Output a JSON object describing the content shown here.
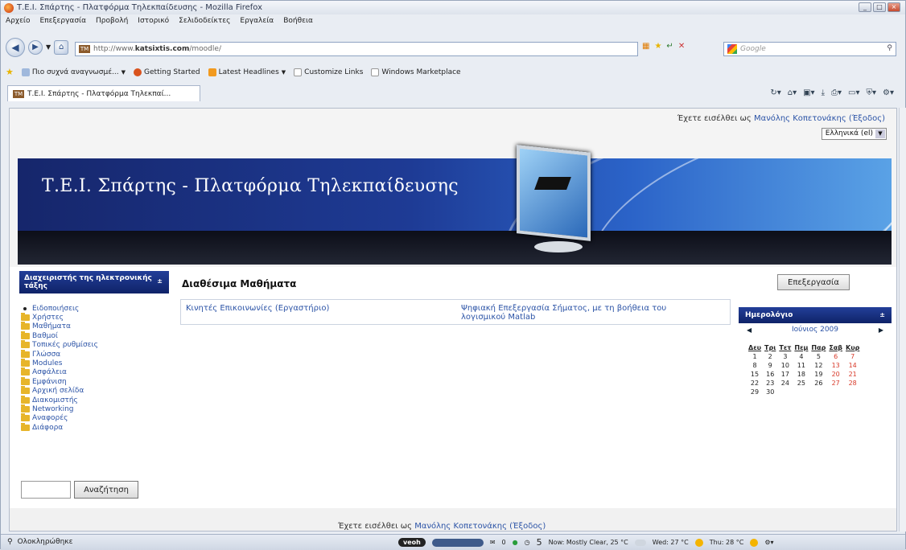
{
  "browser": {
    "window_title": "Τ.Ε.Ι. Σπάρτης - Πλατφόρμα Τηλεκπαίδευσης - Mozilla Firefox",
    "menu": [
      "Αρχείο",
      "Επεξεργασία",
      "Προβολή",
      "Ιστορικό",
      "Σελιδοδείκτες",
      "Εργαλεία",
      "Βοήθεια"
    ],
    "url_prefix": "http://www.",
    "url_domain": "katsixtis.com",
    "url_path": "/moodle/",
    "search_placeholder": "Google",
    "bookmarks": [
      "Πιο συχνά αναγνωσμέ...",
      "Getting Started",
      "Latest Headlines",
      "Customize Links",
      "Windows Marketplace"
    ],
    "tab_title": "Τ.Ε.Ι. Σπάρτης - Πλατφόρμα Τηλεκπαί...",
    "favicon_text": "TM",
    "status_text": "Ολοκληρώθηκε",
    "status": {
      "badge": "veoh",
      "mail": "0",
      "count": "5",
      "now_weather": "Now: Mostly Clear, 25 °C",
      "wed_weather": "Wed: 27 °C",
      "thu_weather": "Thu: 28 °C"
    }
  },
  "page": {
    "login_prefix": "Έχετε εισέλθει ως ",
    "user_name": "Μανόλης Κοπετονάκης",
    "logout_label": "(Έξοδος)",
    "language": "Ελληνικά (el)",
    "banner_title": "Τ.Ε.Ι. Σπάρτης - Πλατφόρμα Τηλεκπαίδευσης",
    "admin_block_title": "Διαχειριστής της ηλεκτρονικής τάξης",
    "admin_items": [
      {
        "label": "Ειδοποιήσεις",
        "icon": "bullet"
      },
      {
        "label": "Χρήστες",
        "icon": "folder-icon"
      },
      {
        "label": "Μαθήματα",
        "icon": "folder-icon"
      },
      {
        "label": "Βαθμοί",
        "icon": "folder-icon"
      },
      {
        "label": "Τοπικές ρυθμίσεις",
        "icon": "folder-icon"
      },
      {
        "label": "Γλώσσα",
        "icon": "folder-icon"
      },
      {
        "label": "Modules",
        "icon": "folder-icon"
      },
      {
        "label": "Ασφάλεια",
        "icon": "folder-icon"
      },
      {
        "label": "Εμφάνιση",
        "icon": "folder-icon"
      },
      {
        "label": "Αρχική σελίδα",
        "icon": "folder-icon"
      },
      {
        "label": "Διακομιστής",
        "icon": "folder-icon"
      },
      {
        "label": "Networking",
        "icon": "folder-icon"
      },
      {
        "label": "Αναφορές",
        "icon": "folder-icon"
      },
      {
        "label": "Διάφορα",
        "icon": "folder-icon"
      }
    ],
    "search_button": "Αναζήτηση",
    "main_title": "Διαθέσιμα Μαθήματα",
    "edit_button": "Επεξεργασία",
    "courses": [
      "Κινητές Επικοινωνίες (Εργαστήριο)",
      "Ψηφιακή Επεξεργασία Σήματος, με τη βοήθεια του λογισμικού Matlab"
    ],
    "calendar": {
      "title": "Ημερολόγιο",
      "month": "Ιούνιος 2009",
      "weekdays": [
        "Δευ",
        "Τρι",
        "Τετ",
        "Πεμ",
        "Παρ",
        "Σαβ",
        "Κυρ"
      ],
      "weeks": [
        [
          "1",
          "2",
          "3",
          "4",
          "5",
          "6",
          "7"
        ],
        [
          "8",
          "9",
          "10",
          "11",
          "12",
          "13",
          "14"
        ],
        [
          "15",
          "16",
          "17",
          "18",
          "19",
          "20",
          "21"
        ],
        [
          "22",
          "23",
          "24",
          "25",
          "26",
          "27",
          "28"
        ],
        [
          "29",
          "30",
          "",
          "",
          "",
          "",
          ""
        ]
      ],
      "weekend_color": "#d83a2a"
    },
    "footer_prefix": "Έχετε εισέλθει ως ",
    "footer_user": "Μανόλης Κοπετονάκης",
    "footer_logout": "(Έξοδος)"
  },
  "colors": {
    "accent_blue": "#1e3b95",
    "link": "#2b53a6",
    "folder": "#e7b52a"
  }
}
